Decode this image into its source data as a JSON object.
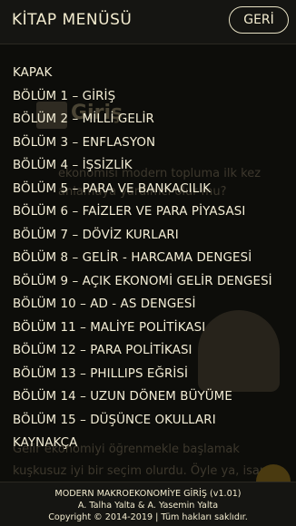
{
  "header": {
    "title": "KİTAP MENÜSÜ",
    "back_label": "GERİ"
  },
  "menu": {
    "items": [
      "KAPAK",
      "BÖLÜM 1  –  GİRİŞ",
      "BÖLÜM 2  –  MİLLİ GELİR",
      "BÖLÜM 3  –  ENFLASYON",
      "BÖLÜM 4  –  İŞSİZLİK",
      "BÖLÜM 5  –  PARA VE BANKACILIK",
      "BÖLÜM 6  –  FAİZLER VE PARA PİYASASI",
      "BÖLÜM 7  –  DÖVİZ KURLARI",
      "BÖLÜM 8  –  GELİR - HARCAMA DENGESİ",
      "BÖLÜM 9  –  AÇIK EKONOMİ GELİR DENGESİ",
      "BÖLÜM 10 – AD - AS DENGESİ",
      "BÖLÜM 11 – MALİYE POLİTİKASI",
      "BÖLÜM 12 – PARA POLİTİKASI",
      "BÖLÜM 13 – PHILLIPS EĞRİSİ",
      "BÖLÜM 14 – UZUN DÖNEM BÜYÜME",
      "BÖLÜM 15 – DÜŞÜNCE OKULLARI",
      "KAYNAKÇA"
    ]
  },
  "footer": {
    "line1": "MODERN MAKROEKONOMİYE GİRİŞ    (v1.01)",
    "line2": "A. Talha Yalta  &  A. Yasemin Yalta",
    "line3": "Copyright © 2014-2019  |  Tüm hakları saklıdır."
  },
  "background": {
    "title": "Giriş",
    "lines": [
      "ekonomisi modern topluma ilk kez",
      "anlamaya yardımcı olur mu?",
      "Gelir ekonomiyi öğrenmekle başlamak",
      "kuşkusuz iyi bir seçim olurdu. Öyle ya, isan"
    ]
  }
}
